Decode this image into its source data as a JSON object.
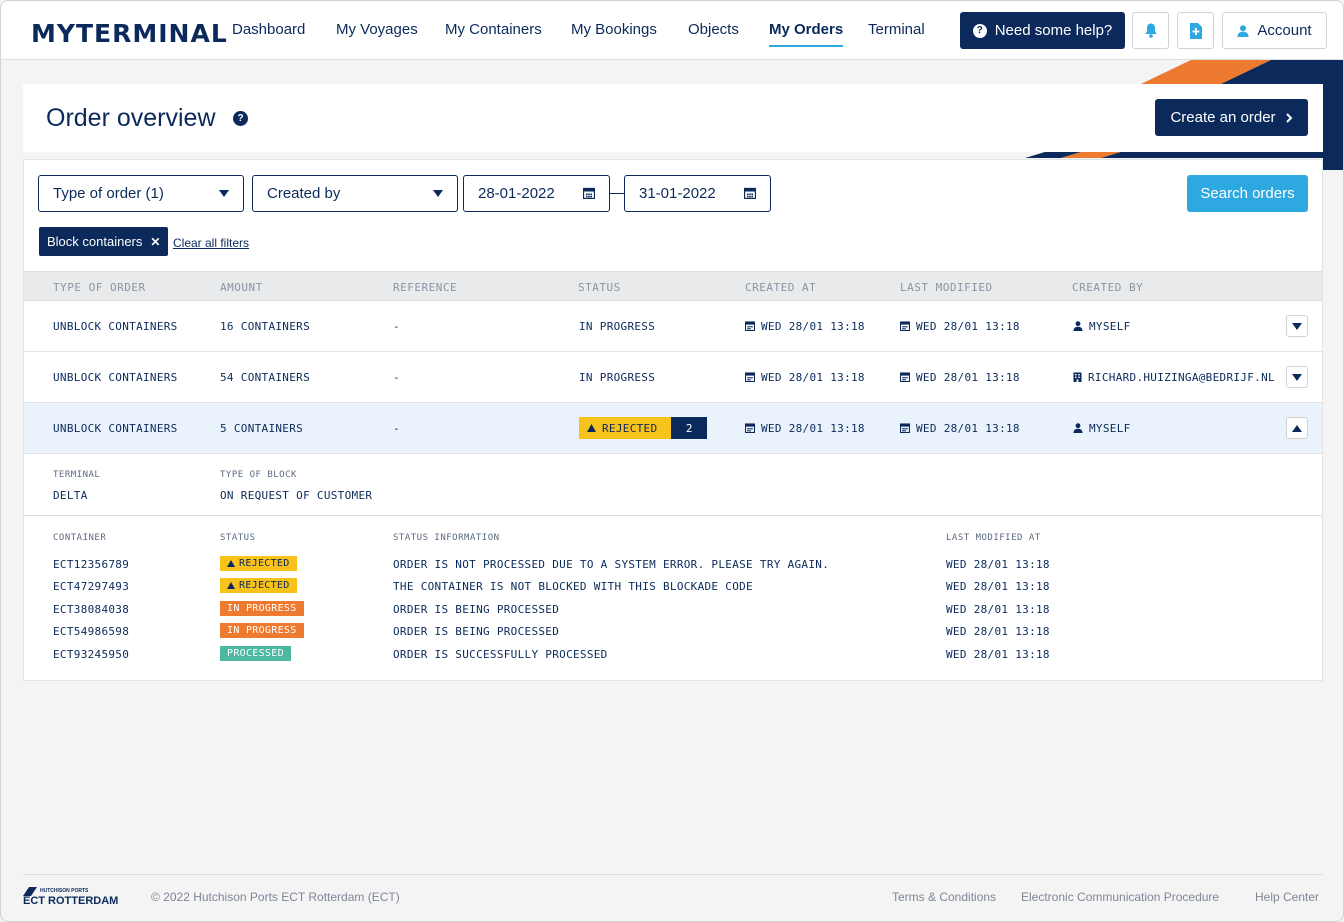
{
  "brand": {
    "logo_text": "MYTERMINAL",
    "footer_small": "HUTCHISON PORTS",
    "footer_big": "ECT ROTTERDAM"
  },
  "nav": {
    "items": [
      {
        "label": "Dashboard"
      },
      {
        "label": "My Voyages"
      },
      {
        "label": "My Containers"
      },
      {
        "label": "My Bookings"
      },
      {
        "label": "Objects"
      },
      {
        "label": "My Orders",
        "active": true
      },
      {
        "label": "Terminal"
      }
    ],
    "help_label": "Need some help?",
    "account_label": "Account"
  },
  "header": {
    "title": "Order overview",
    "create_label": "Create an order"
  },
  "filters": {
    "type_of_order": "Type of order (1)",
    "created_by": "Created by",
    "date_from": "28-01-2022",
    "date_to": "31-01-2022",
    "search_label": "Search orders",
    "active_chip": "Block containers",
    "clear_label": "Clear all filters"
  },
  "table": {
    "headers": [
      "TYPE OF ORDER",
      "AMOUNT",
      "REFERENCE",
      "STATUS",
      "CREATED AT",
      "LAST MODIFIED",
      "CREATED BY"
    ],
    "rows": [
      {
        "type": "UNBLOCK CONTAINERS",
        "amount": "16 CONTAINERS",
        "reference": "-",
        "status": "IN PROGRESS",
        "created_at": "WED 28/01 13:18",
        "last_modified": "WED 28/01 13:18",
        "created_by": "MYSELF",
        "created_by_icon": "user-icon"
      },
      {
        "type": "UNBLOCK CONTAINERS",
        "amount": "54 CONTAINERS",
        "reference": "-",
        "status": "IN PROGRESS",
        "created_at": "WED 28/01 13:18",
        "last_modified": "WED 28/01 13:18",
        "created_by": "RICHARD.HUIZINGA@BEDRIJF.NL",
        "created_by_icon": "building-icon"
      },
      {
        "type": "UNBLOCK CONTAINERS",
        "amount": "5 CONTAINERS",
        "reference": "-",
        "status": "REJECTED",
        "status_count": "2",
        "created_at": "WED 28/01 13:18",
        "last_modified": "WED 28/01 13:18",
        "created_by": "MYSELF",
        "created_by_icon": "user-icon",
        "expanded": true
      }
    ]
  },
  "detail": {
    "terminal_label": "TERMINAL",
    "terminal_value": "DELTA",
    "block_label": "TYPE OF BLOCK",
    "block_value": "ON REQUEST OF CUSTOMER",
    "sub_headers": [
      "CONTAINER",
      "STATUS",
      "STATUS INFORMATION",
      "LAST MODIFIED AT"
    ],
    "containers": [
      {
        "id": "ECT12356789",
        "status": "REJECTED",
        "info": "ORDER IS NOT PROCESSED DUE TO A SYSTEM ERROR. PLEASE TRY AGAIN.",
        "modified": "WED 28/01 13:18"
      },
      {
        "id": "ECT47297493",
        "status": "REJECTED",
        "info": "THE CONTAINER IS NOT BLOCKED WITH THIS BLOCKADE CODE",
        "modified": "WED 28/01 13:18"
      },
      {
        "id": "ECT38084038",
        "status": "IN PROGRESS",
        "info": "ORDER IS BEING PROCESSED",
        "modified": "WED 28/01 13:18"
      },
      {
        "id": "ECT54986598",
        "status": "IN PROGRESS",
        "info": "ORDER IS BEING PROCESSED",
        "modified": "WED 28/01 13:18"
      },
      {
        "id": "ECT93245950",
        "status": "PROCESSED",
        "info": "ORDER IS SUCCESSFULLY PROCESSED",
        "modified": "WED 28/01 13:18"
      }
    ]
  },
  "footer": {
    "copyright": "© 2022 Hutchison Ports ECT Rotterdam (ECT)",
    "links": [
      "Terms & Conditions",
      "Electronic Communication Procedure",
      "Help Center"
    ]
  },
  "colors": {
    "navy": "#0b2a5b",
    "accent_blue": "#2da8e0",
    "orange": "#ee7a30",
    "yellow": "#f7c21a",
    "green": "#4cb8a0"
  }
}
